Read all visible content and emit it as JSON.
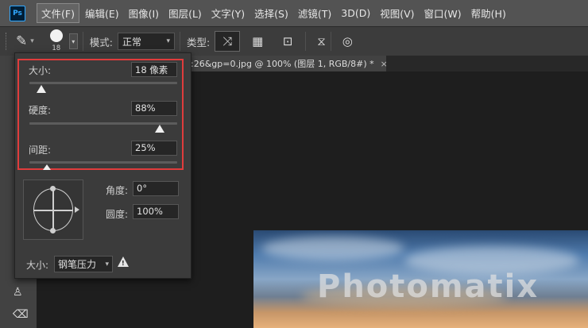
{
  "app": {
    "logo": "Ps"
  },
  "menu": [
    "文件(F)",
    "编辑(E)",
    "图像(I)",
    "图层(L)",
    "文字(Y)",
    "选择(S)",
    "滤镜(T)",
    "3D(D)",
    "视图(V)",
    "窗口(W)",
    "帮助(H)"
  ],
  "options_bar": {
    "tool_icon": "healing-brush-icon",
    "brush_size_preview": "18",
    "mode_label": "模式:",
    "mode_value": "正常",
    "type_label": "类型:",
    "type_buttons": [
      "content-aware-icon",
      "create-texture-icon",
      "proximity-match-icon"
    ],
    "extra_icons": [
      "sample-all-layers-icon",
      "pressure-icon"
    ]
  },
  "document_tab": {
    "title": ":26&gp=0.jpg @ 100% (图层 1, RGB/8#) *",
    "close": "×"
  },
  "brush_panel": {
    "size": {
      "label": "大小:",
      "value": "18 像素",
      "level_fraction": 0.08
    },
    "hardness": {
      "label": "硬度:",
      "value": "88%",
      "level_fraction": 0.88
    },
    "spacing": {
      "label": "间距:",
      "value": "25%",
      "level_fraction": 0.12
    },
    "angle": {
      "label": "角度:",
      "value": "0°"
    },
    "roundness": {
      "label": "圆度:",
      "value": "100%"
    },
    "control_label": "大小:",
    "control_value": "钢笔压力",
    "warning_icon": "warning-icon"
  },
  "canvas": {
    "watermark_text": "Photomatix"
  },
  "colors": {
    "highlight": "#e03c3c",
    "menubar": "#535353",
    "panel": "#3b3b3b"
  }
}
